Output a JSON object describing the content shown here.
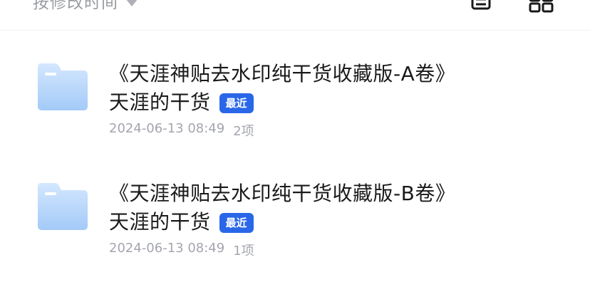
{
  "toolbar": {
    "sort_label": "按修改时间",
    "sort_icon": "caret-down-icon",
    "list_view_icon": "list-view-icon",
    "grid_view_icon": "grid-view-icon"
  },
  "colors": {
    "accent": "#2a67e8",
    "folder_light": "#cfe3fd",
    "folder_dark": "#9cc6f7",
    "text_primary": "#1a1a1a",
    "text_secondary": "#a3a6ad"
  },
  "files": [
    {
      "name": "《天涯神贴去水印纯干货收藏版-A卷》",
      "owner": "天涯的干货",
      "badge": "最近",
      "modified": "2024-06-13 08:49",
      "count": "2项",
      "icon": "folder-icon"
    },
    {
      "name": "《天涯神贴去水印纯干货收藏版-B卷》",
      "owner": "天涯的干货",
      "badge": "最近",
      "modified": "2024-06-13 08:49",
      "count": "1项",
      "icon": "folder-icon"
    }
  ]
}
